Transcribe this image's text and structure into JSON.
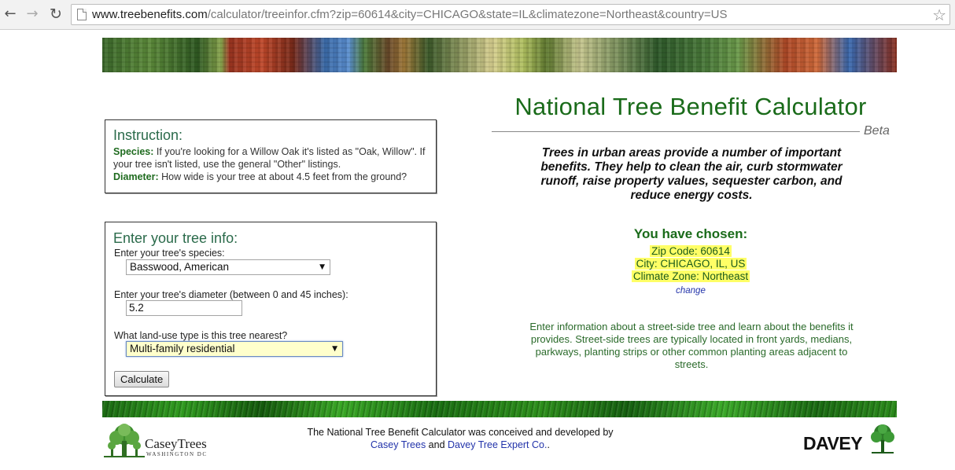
{
  "browser": {
    "url_host": "www.treebenefits.com",
    "url_path": "/calculator/treeinfor.cfm?zip=60614&city=CHICAGO&state=IL&climatezone=Northeast&country=US"
  },
  "instruction": {
    "title": "Instruction:",
    "species_label": "Species:",
    "species_text": " If you're looking for a Willow Oak it's listed as \"Oak, Willow\". If your tree isn't listed, use the general \"Other\" listings.",
    "diameter_label": "Diameter:",
    "diameter_text": " How wide is your tree at about 4.5 feet from the ground?"
  },
  "form": {
    "title": "Enter your tree info:",
    "species_label": "Enter your tree's species:",
    "species_value": "Basswood, American",
    "diameter_label": "Enter your tree's diameter (between 0 and 45 inches):",
    "diameter_value": "5.2",
    "landuse_label": "What land-use type is this tree nearest?",
    "landuse_value": "Multi-family residential",
    "calculate_label": "Calculate"
  },
  "main": {
    "title": "National Tree Benefit Calculator",
    "beta": "Beta",
    "intro": "Trees in urban areas provide a number of important benefits. They help to clean the air, curb stormwater runoff, raise property values, sequester carbon, and reduce energy costs.",
    "chosen_title": "You have chosen:",
    "zip": "Zip Code: 60614",
    "city": "City: CHICAGO, IL, US",
    "climate": "Climate Zone: Northeast",
    "change": "change",
    "info": "Enter information about a street-side tree and learn about the benefits it provides. Street-side trees are typically located in front yards, medians, parkways, planting strips or other common planting areas adjacent to streets."
  },
  "footer": {
    "casey_name": "CaseyTrees",
    "casey_sub": "WASHINGTON DC",
    "text_before": "The National Tree Benefit Calculator was conceived and developed by",
    "casey_link": "Casey Trees",
    "and": " and ",
    "davey_link": "Davey Tree Expert Co.",
    "period": ".",
    "davey_logo": "DAVEY"
  },
  "colors": {
    "title_green": "#1a6b1a",
    "highlight": "#ffff66",
    "link_blue": "#2233aa"
  }
}
